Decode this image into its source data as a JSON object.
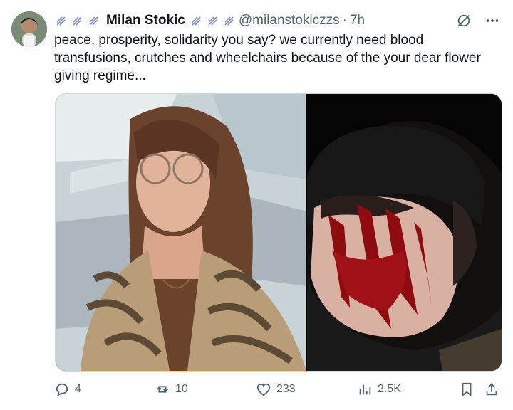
{
  "author": {
    "name": "Milan Stokic",
    "handle": "@milanstokiczzs",
    "separator": "·",
    "time": "7h",
    "decorations": [
      "dna-icon",
      "dna-icon",
      "dna-icon"
    ]
  },
  "tweet": {
    "text": "peace, prosperity, solidarity you say?  we currently need blood transfusions, crutches and wheelchairs because of the your dear flower giving regime..."
  },
  "actions": {
    "replies": "4",
    "reposts": "10",
    "likes": "233",
    "views": "2.5K"
  },
  "colors": {
    "text": "#0f1419",
    "secondary": "#536471",
    "dna": "#7b88c9"
  }
}
